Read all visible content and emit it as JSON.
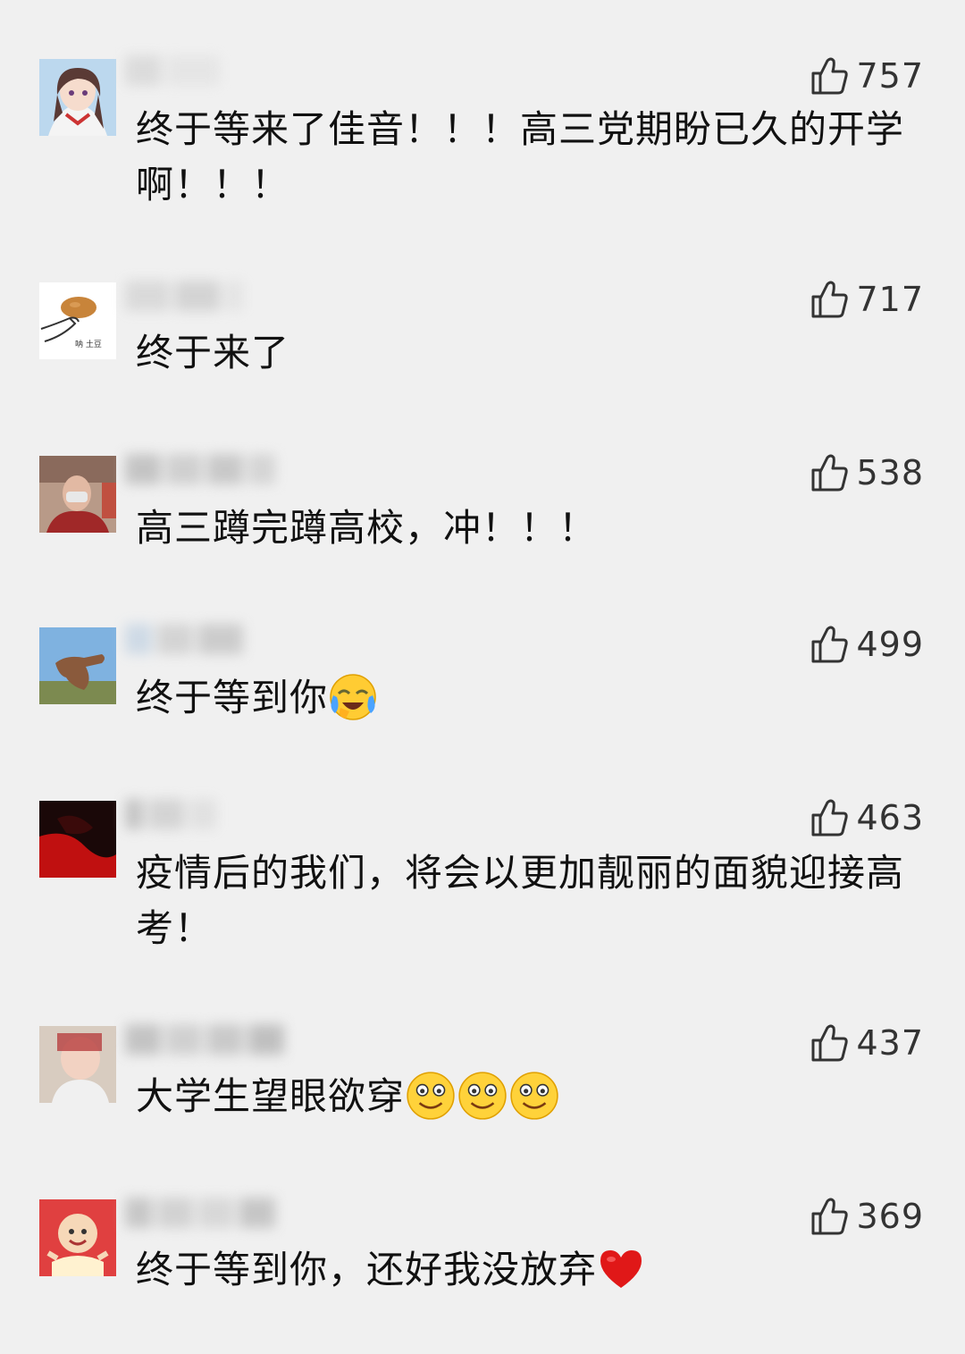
{
  "comments": [
    {
      "likes": "757",
      "text": "终于等来了佳音！！！高三党期盼已久的开学啊！！！"
    },
    {
      "likes": "717",
      "text": "终于来了"
    },
    {
      "likes": "538",
      "text": "高三蹲完蹲高校，冲！！！"
    },
    {
      "likes": "499",
      "text": "终于等到你"
    },
    {
      "likes": "463",
      "text": "疫情后的我们，将会以更加靓丽的面貌迎接高考！"
    },
    {
      "likes": "437",
      "text": "大学生望眼欲穿"
    },
    {
      "likes": "369",
      "text": "终于等到你，还好我没放弃"
    }
  ],
  "icons": {
    "like": "thumbs-up-outline-icon",
    "emoji_cry_laugh": "crying-face-emoji",
    "emoji_smile": "smiling-face-emoji",
    "emoji_heart": "red-heart-emoji"
  },
  "avatar_labels": {
    "potato": "呐 土豆"
  }
}
